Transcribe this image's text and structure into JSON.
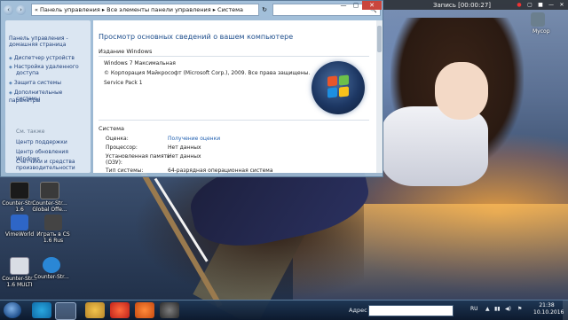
{
  "recording": {
    "title": "Запись [00:00:27]",
    "buttons": [
      "●",
      "▢",
      "■",
      "—",
      "✕"
    ]
  },
  "window": {
    "address_path": "«  Панель управления  ▸  Все элементы панели управления  ▸  Система",
    "search_placeholder": "🔍",
    "controls": {
      "minimize": "—",
      "maximize": "▢",
      "close": "✕"
    },
    "sidebar": {
      "home": [
        "Панель управления -",
        "домашняя страница"
      ],
      "links": [
        "Диспетчер устройств",
        "Настройка удаленного",
        "доступа",
        "Защита системы",
        "Дополнительные параметры",
        "системы"
      ],
      "see_also": "См. также",
      "see_links": [
        "Центр поддержки",
        "Центр обновления Windows",
        "Счетчики и средства",
        "производительности"
      ]
    },
    "content": {
      "title": "Просмотр основных сведений о вашем компьютере",
      "edition_heading": "Издание Windows",
      "edition_lines": [
        "Windows 7 Максимальная",
        "© Корпорация Майкрософт (Microsoft Corp.), 2009. Все права защищены.",
        "Service Pack 1"
      ],
      "system_heading": "Система",
      "rows": [
        {
          "label": "Оценка:",
          "value": "Получение оценки",
          "link": true
        },
        {
          "label": "Процессор:",
          "value": "Нет данных"
        },
        {
          "label": "Установленная память",
          "value": "Нет данных"
        },
        {
          "label": "(ОЗУ):",
          "value": ""
        },
        {
          "label": "Тип системы:",
          "value": "64-разрядная операционная система"
        }
      ]
    }
  },
  "desktop_icons": [
    {
      "name": "counter-strike-16",
      "label": "Counter-Str... 1.6",
      "color": "#1a1a1a"
    },
    {
      "name": "counter-strike-go",
      "label": "Counter-Str... Global Offe...",
      "color": "#3a3a3a"
    },
    {
      "name": "vimeworld",
      "label": "VimeWorld",
      "color": "#2e66c7"
    },
    {
      "name": "igrat-v-cs",
      "label": "Играть в CS 1.6 Rus",
      "color": "#444"
    },
    {
      "name": "counter-strike-mult",
      "label": "Counter-Str... 1.6 MULTI",
      "color": "#d9dde4"
    },
    {
      "name": "counter-strike-fav",
      "label": "Counter-Str...",
      "color": "#2a87d6"
    }
  ],
  "right_icons": [
    "Мусор"
  ],
  "taskbar": {
    "address_label": "Адрес",
    "lang": "RU",
    "time": "21:38",
    "date": "10.10.2016"
  },
  "colors": {
    "accent": "#1e4e8c",
    "link": "#1f5fb0",
    "close_button": "#c9463d"
  }
}
